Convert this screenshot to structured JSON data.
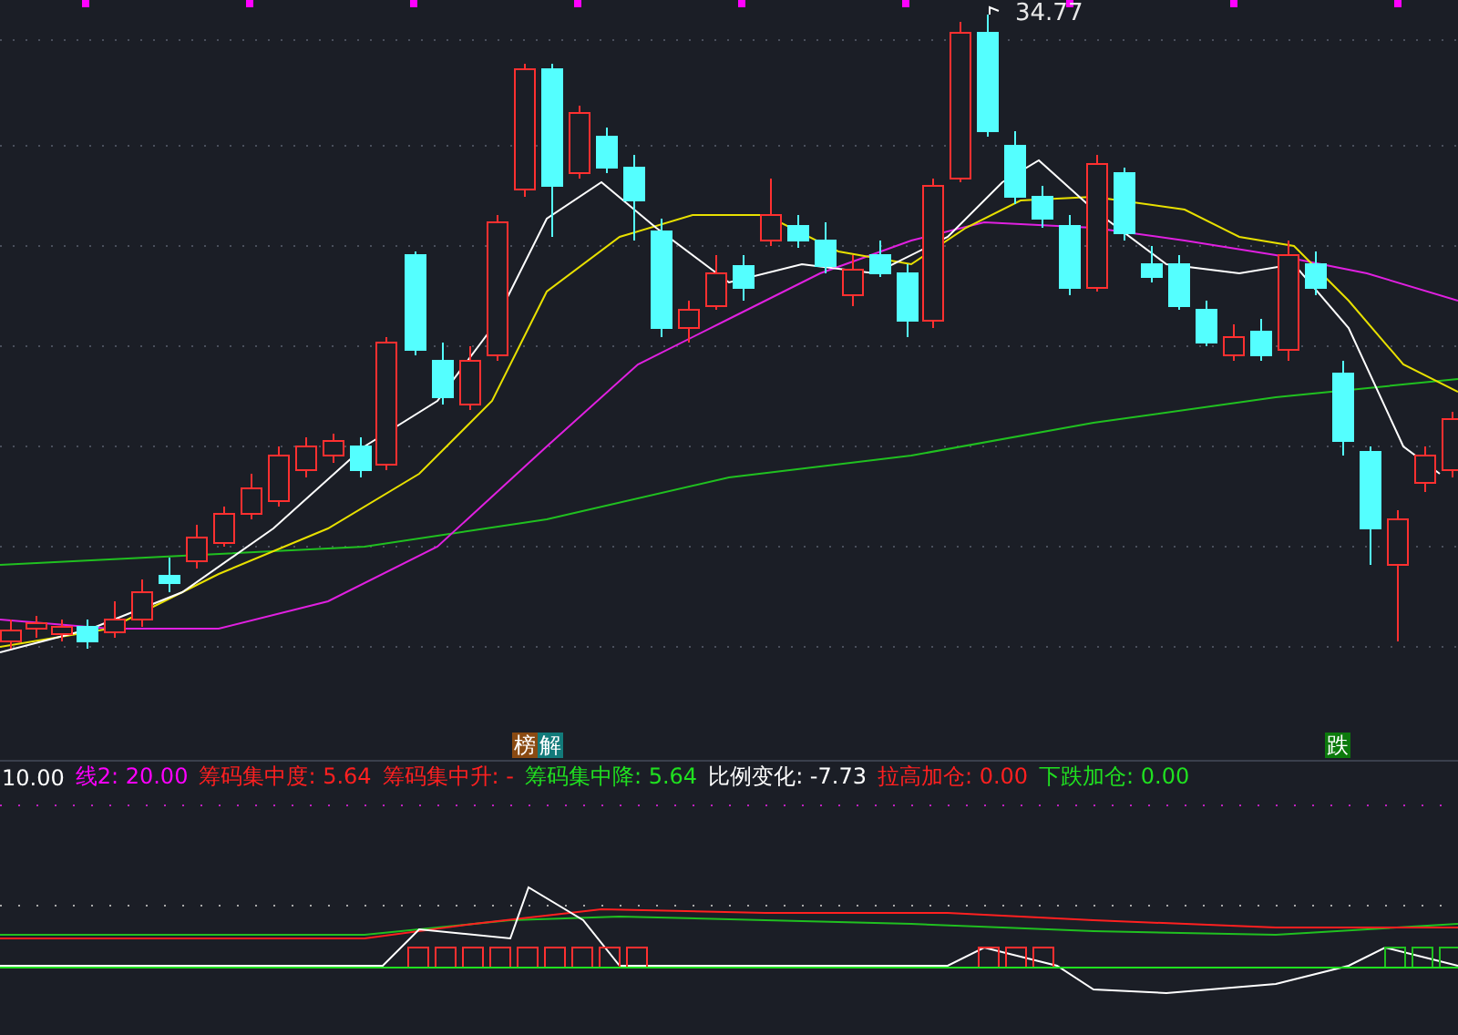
{
  "main_chart": {
    "peak_label": "34.77",
    "signal_tags": [
      {
        "text": "榜",
        "color": "#8a4a12"
      },
      {
        "text": "解",
        "color": "#127a7a"
      },
      {
        "text": "跌",
        "color": "#0c7a0c"
      }
    ]
  },
  "indicator_legend": [
    {
      "text": "10.00",
      "color": "#ffffff"
    },
    {
      "text": "线2: 20.00",
      "color": "#ff00ff"
    },
    {
      "text": "筹码集中度: 5.64",
      "color": "#ff2020"
    },
    {
      "text": "筹码集中升: -",
      "color": "#ff2020"
    },
    {
      "text": "筹码集中降: 5.64",
      "color": "#20e020"
    },
    {
      "text": "比例变化: -7.73",
      "color": "#ffffff"
    },
    {
      "text": "拉高加仓: 0.00",
      "color": "#ff2020"
    },
    {
      "text": "下跌加仓: 0.00",
      "color": "#20e020"
    }
  ]
}
